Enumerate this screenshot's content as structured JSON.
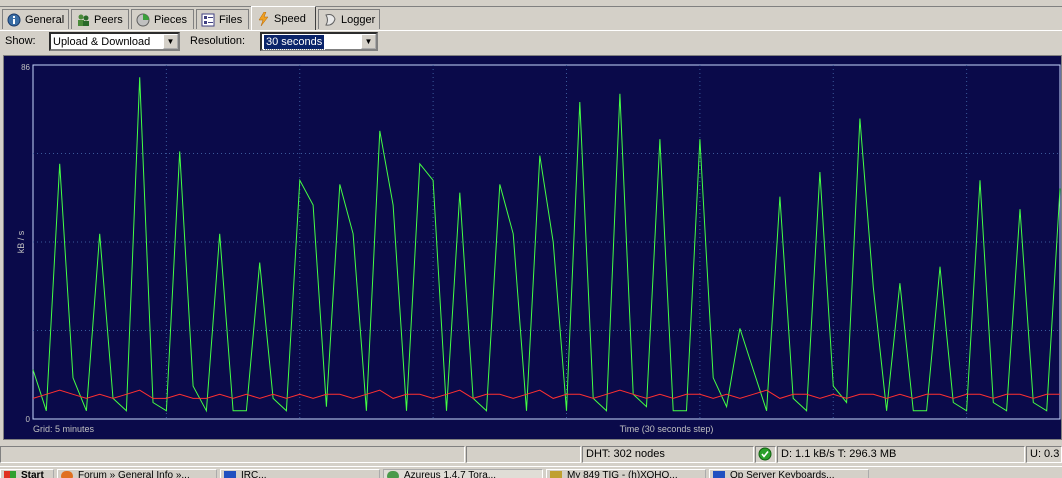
{
  "tabs": [
    {
      "label": "General",
      "icon": "info-icon"
    },
    {
      "label": "Peers",
      "icon": "peers-icon"
    },
    {
      "label": "Pieces",
      "icon": "pieces-icon"
    },
    {
      "label": "Files",
      "icon": "files-icon"
    },
    {
      "label": "Speed",
      "icon": "lightning-icon"
    },
    {
      "label": "Logger",
      "icon": "logger-icon"
    }
  ],
  "active_tab": "Speed",
  "toolbar": {
    "show_label": "Show:",
    "show_value": "Upload & Download",
    "resolution_label": "Resolution:",
    "resolution_value": "30 seconds"
  },
  "chart_data": {
    "type": "line",
    "ylabel": "kB / s",
    "xlabel": "Time (30 seconds step)",
    "grid_note": "Grid: 5 minutes",
    "y_ticks": [
      "86",
      "0"
    ],
    "ylim": [
      0,
      86
    ],
    "grid": true,
    "colors": {
      "background": "#0a0a4a",
      "grid": "#3a5a9a",
      "download": "#44ff44",
      "upload": "#ff3030"
    },
    "series": [
      {
        "color": "#44ff44",
        "values": [
          12,
          2,
          62,
          10,
          2,
          45,
          5,
          2,
          83,
          4,
          2,
          65,
          8,
          2,
          45,
          2,
          2,
          38,
          5,
          2,
          58,
          52,
          3,
          57,
          45,
          2,
          70,
          52,
          2,
          62,
          58,
          2,
          55,
          5,
          2,
          57,
          45,
          2,
          64,
          43,
          2,
          77,
          5,
          2,
          79,
          6,
          3,
          68,
          2,
          2,
          68,
          10,
          3,
          22,
          12,
          2,
          54,
          5,
          2,
          60,
          8,
          4,
          73,
          32,
          2,
          33,
          2,
          2,
          37,
          4,
          2,
          58,
          4,
          2,
          51,
          4,
          2,
          56
        ]
      },
      {
        "color": "#ff3030",
        "values": [
          5,
          6,
          7,
          6,
          5,
          6,
          5,
          6,
          7,
          5,
          5,
          6,
          5,
          5,
          6,
          5,
          6,
          5,
          6,
          5,
          6,
          5,
          6,
          6,
          5,
          6,
          7,
          5,
          6,
          6,
          5,
          6,
          7,
          5,
          6,
          6,
          5,
          6,
          7,
          5,
          6,
          6,
          5,
          6,
          7,
          6,
          5,
          6,
          5,
          6,
          6,
          5,
          6,
          5,
          6,
          7,
          5,
          6,
          6,
          5,
          6,
          5,
          6,
          6,
          5,
          6,
          5,
          6,
          6,
          5,
          6,
          6,
          5,
          6,
          6,
          5,
          6,
          6
        ]
      }
    ]
  },
  "status": {
    "dht": "DHT: 302 nodes",
    "transfer": "D: 1.1 kB/s T: 296.3 MB",
    "upload": "U: 0.3"
  },
  "taskbar": [
    {
      "label": "Start",
      "icon": "windows-flag-icon"
    },
    {
      "label": "Forum » General Info »...",
      "icon": "browser-icon"
    },
    {
      "label": "IRC...",
      "icon": "irc-icon"
    },
    {
      "label": "Azureus 1.4.7 Tora...",
      "icon": "azureus-icon"
    },
    {
      "label": "My 849 TIG - (h)ХОНО...",
      "icon": "window-icon"
    },
    {
      "label": "Op Server Keyboards...",
      "icon": "window-icon"
    }
  ]
}
